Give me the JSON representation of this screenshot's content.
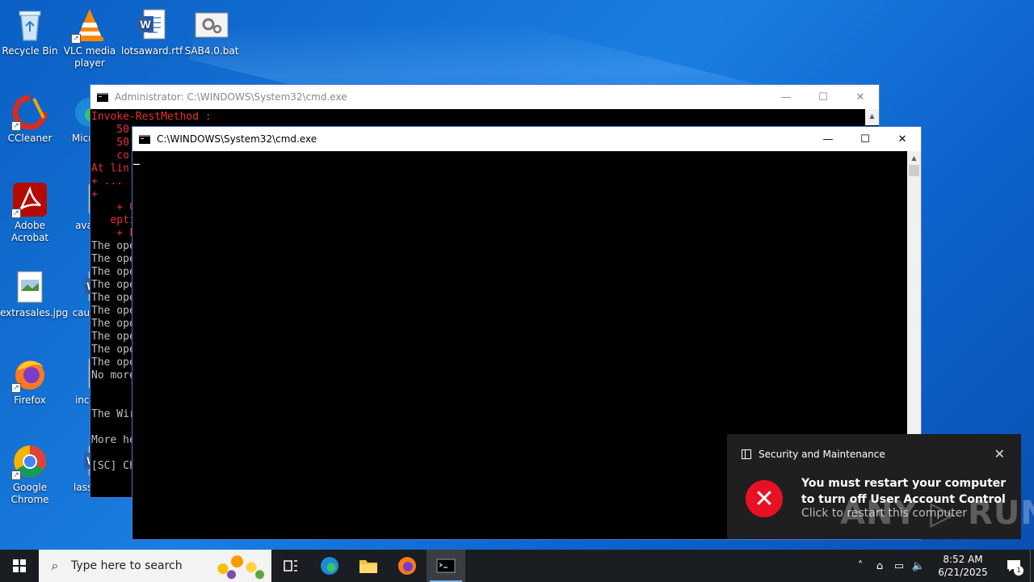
{
  "desktop": {
    "icons": [
      {
        "label": "Recycle Bin",
        "icon": "recycle-bin-icon"
      },
      {
        "label": "VLC media player",
        "icon": "vlc-icon"
      },
      {
        "label": "lotsaward.rtf",
        "icon": "word-document-icon"
      },
      {
        "label": "SAB4.0.bat",
        "icon": "batch-file-icon"
      },
      {
        "label": "CCleaner",
        "icon": "ccleaner-icon"
      },
      {
        "label": "Micr Ed",
        "icon": "edge-icon"
      },
      {
        "label": "Adobe Acrobat",
        "icon": "acrobat-icon"
      },
      {
        "label": "availa",
        "icon": "image-file-icon"
      },
      {
        "label": "extrasales.jpg",
        "icon": "image-file-icon"
      },
      {
        "label": "causeh",
        "icon": "word-document-icon"
      },
      {
        "label": "Firefox",
        "icon": "firefox-icon"
      },
      {
        "label": "includ",
        "icon": "image-file-icon"
      },
      {
        "label": "Google Chrome",
        "icon": "chrome-icon"
      },
      {
        "label": "lasstor",
        "icon": "word-document-icon"
      }
    ]
  },
  "window_admin": {
    "title": "Administrator: C:\\WINDOWS\\System32\\cmd.exe",
    "lines": [
      {
        "text": "Invoke-RestMethod :",
        "color": "red"
      },
      {
        "text": "    50",
        "color": "red"
      },
      {
        "text": "    50",
        "color": "red"
      },
      {
        "text": "    co",
        "color": "red"
      },
      {
        "text": "At lin",
        "color": "red"
      },
      {
        "text": "+ ...",
        "color": "red"
      },
      {
        "text": "+",
        "color": "red"
      },
      {
        "text": "    + C",
        "color": "red"
      },
      {
        "text": "   epti",
        "color": "red"
      },
      {
        "text": "    + F",
        "color": "red"
      },
      {
        "text": "The ope",
        "color": "gray"
      },
      {
        "text": "The ope",
        "color": "gray"
      },
      {
        "text": "The ope",
        "color": "gray"
      },
      {
        "text": "The ope",
        "color": "gray"
      },
      {
        "text": "The ope",
        "color": "gray"
      },
      {
        "text": "The ope",
        "color": "gray"
      },
      {
        "text": "The ope",
        "color": "gray"
      },
      {
        "text": "The ope",
        "color": "gray"
      },
      {
        "text": "The ope",
        "color": "gray"
      },
      {
        "text": "The ope",
        "color": "gray"
      },
      {
        "text": "No more",
        "color": "gray"
      },
      {
        "text": "",
        "color": "gray"
      },
      {
        "text": "",
        "color": "gray"
      },
      {
        "text": "The Wir",
        "color": "gray"
      },
      {
        "text": "",
        "color": "gray"
      },
      {
        "text": "More he",
        "color": "gray"
      },
      {
        "text": "",
        "color": "gray"
      },
      {
        "text": "[SC] Ch",
        "color": "gray"
      }
    ]
  },
  "window_cmd": {
    "title": "C:\\WINDOWS\\System32\\cmd.exe",
    "cursor": "_"
  },
  "window_controls": {
    "minimize": "—",
    "maximize": "☐",
    "close": "✕"
  },
  "toast": {
    "app": "Security and Maintenance",
    "message": "You must restart your computer to turn off User Account Control",
    "action": "Click to restart this computer",
    "close": "✕",
    "error_glyph": "✕"
  },
  "watermark": "ANY ▷ RUN",
  "taskbar": {
    "search_placeholder": "Type here to search",
    "time": "8:52 AM",
    "date": "6/21/2025",
    "notification_count": "1",
    "tray_icons": [
      "chevron-up-icon",
      "device-icon",
      "network-icon",
      "volume-icon"
    ]
  }
}
